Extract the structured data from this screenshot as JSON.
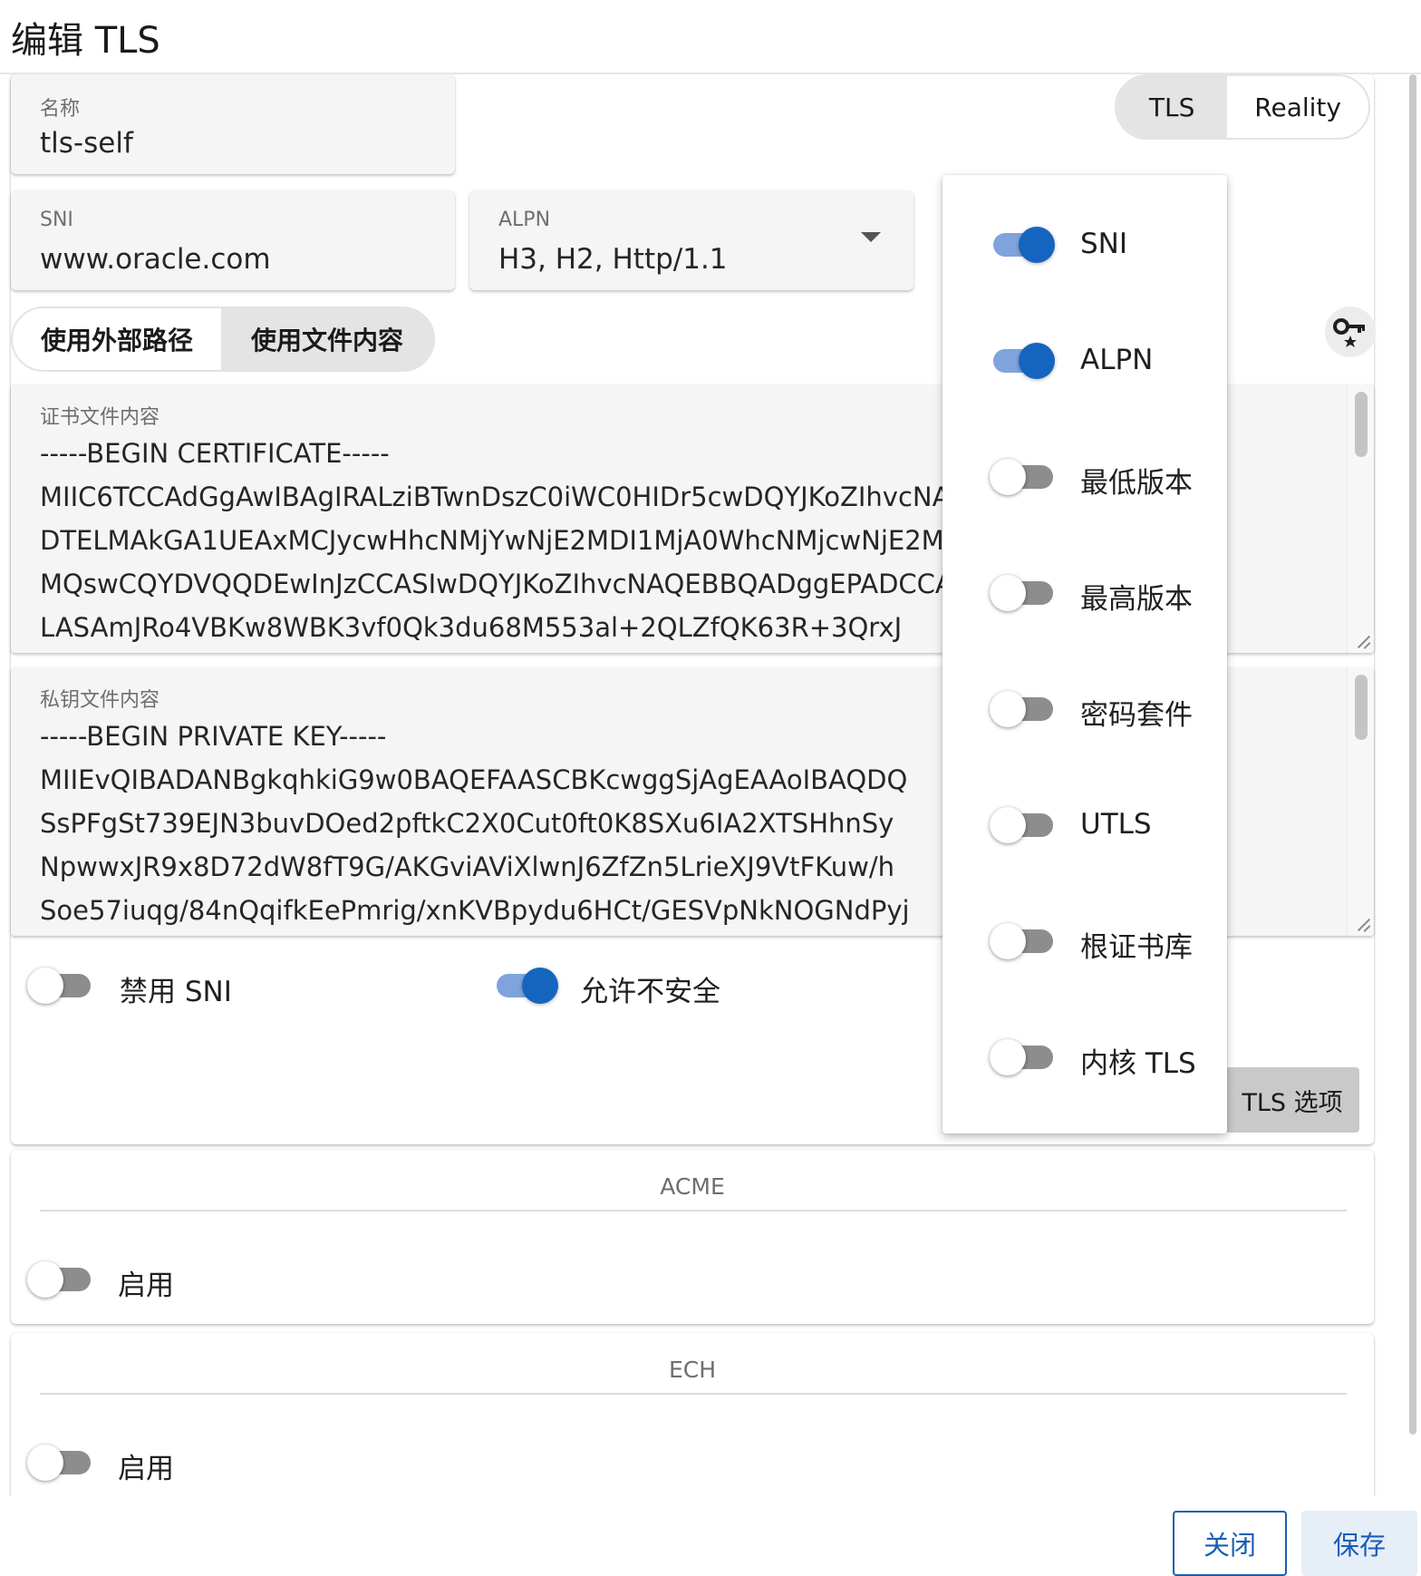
{
  "dialog": {
    "title": "编辑 TLS"
  },
  "name_field": {
    "label": "名称",
    "value": "tls-self"
  },
  "mode_toggle": {
    "options": [
      "TLS",
      "Reality"
    ],
    "selected": "TLS"
  },
  "sni_field": {
    "label": "SNI",
    "value": "www.oracle.com"
  },
  "alpn_field": {
    "label": "ALPN",
    "value": "H3, H2, Http/1.1"
  },
  "cert_source": {
    "options": [
      "使用外部路径",
      "使用文件内容"
    ],
    "selected": "使用文件内容"
  },
  "cert_content": {
    "label": "证书文件内容",
    "lines": [
      "-----BEGIN CERTIFICATE-----",
      "MIIC6TCCAdGgAwIBAgIRALziBTwnDszC0iWC0HIDr5cwDQYJKoZIhvcNAQELBQAw",
      "DTELMAkGA1UEAxMCJycwHhcNMjYwNjE2MDI1MjA0WhcNMjcwNjE2MDI1MjA0WjAN",
      "MQswCQYDVQQDEwInJzCCASIwDQYJKoZIhvcNAQEBBQADggEPADCCAQoCggEBAM",
      "LASAmJRo4VBKw8WBK3vf0Qk3du68M553al+2QLZfQK63R+3QrxJ"
    ]
  },
  "key_content": {
    "label": "私钥文件内容",
    "lines": [
      "-----BEGIN PRIVATE KEY-----",
      "MIIEvQIBADANBgkqhkiG9w0BAQEFAASCBKcwggSjAgEAAoIBAQDQ",
      "SsPFgSt739EJN3buvDOed2pftkC2X0Cut0ft0K8SXu6IA2XTSHhnSy",
      "NpwwxJR9x8D72dW8fT9G/AKGviAViXlwnJ6ZfZn5LrieXJ9VtFKuw/h",
      "Soe57iuqg/84nQqifkEePmrig/xnKVBpydu6HCt/GESVpNkNOGNdPyj"
    ]
  },
  "disable_sni": {
    "label": "禁用 SNI",
    "on": false
  },
  "allow_insecure": {
    "label": "允许不安全",
    "on": true
  },
  "tls_options_button": {
    "label": "TLS 选项"
  },
  "tls_options_menu": {
    "items": [
      {
        "label": "SNI",
        "on": true
      },
      {
        "label": "ALPN",
        "on": true
      },
      {
        "label": "最低版本",
        "on": false
      },
      {
        "label": "最高版本",
        "on": false
      },
      {
        "label": "密码套件",
        "on": false
      },
      {
        "label": "UTLS",
        "on": false
      },
      {
        "label": "根证书库",
        "on": false
      },
      {
        "label": "内核 TLS",
        "on": false
      }
    ]
  },
  "acme": {
    "title": "ACME",
    "enable_label": "启用",
    "on": false
  },
  "ech": {
    "title": "ECH",
    "enable_label": "启用",
    "on": false
  },
  "footer": {
    "close_label": "关闭",
    "save_label": "保存"
  },
  "colors": {
    "accent": "#1565c0",
    "track_on": "#7fa3dc",
    "track_off": "#8d8d8d",
    "field_bg": "#f5f5f5"
  },
  "icons": {
    "key_button": "key-star-icon",
    "alpn_dropdown": "caret-down-icon"
  }
}
